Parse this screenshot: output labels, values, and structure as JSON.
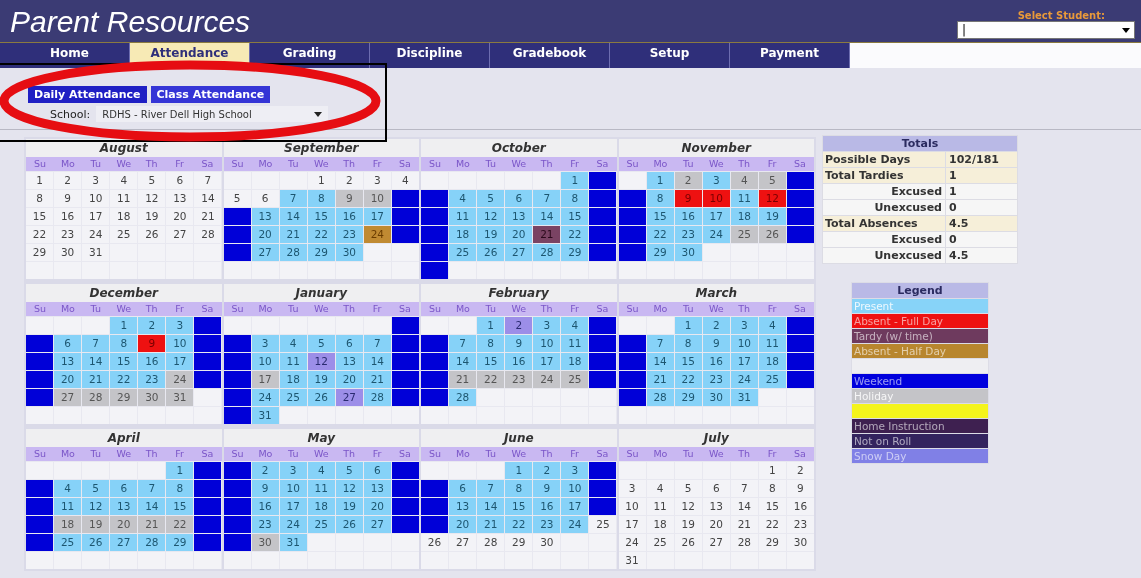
{
  "header": {
    "title": "Parent Resources",
    "student_label": "Select Student:",
    "student_value": "|"
  },
  "tabs": [
    {
      "label": "Home",
      "selected": false
    },
    {
      "label": "Attendance",
      "selected": true
    },
    {
      "label": "Grading",
      "selected": false
    },
    {
      "label": "Discipline",
      "selected": false
    },
    {
      "label": "Gradebook",
      "selected": false
    },
    {
      "label": "Setup",
      "selected": false
    },
    {
      "label": "Payment",
      "selected": false
    }
  ],
  "subtabs": [
    {
      "label": "Daily Attendance",
      "selected": true
    },
    {
      "label": "Class Attendance",
      "selected": false
    }
  ],
  "school": {
    "label": "School:",
    "value": "RDHS - River Dell High School"
  },
  "months": [
    {
      "name": "August",
      "weekdays": [
        "Su",
        "Mo",
        "Tu",
        "We",
        "Th",
        "Fr",
        "Sa"
      ],
      "weeks": [
        [
          {
            "day": "1",
            "kind": "none"
          },
          {
            "day": "2",
            "kind": "none"
          },
          {
            "day": "3",
            "kind": "none"
          },
          {
            "day": "4",
            "kind": "none"
          },
          {
            "day": "5",
            "kind": "none"
          },
          {
            "day": "6",
            "kind": "none"
          },
          {
            "day": "7",
            "kind": "none"
          }
        ],
        [
          {
            "day": "8",
            "kind": "none"
          },
          {
            "day": "9",
            "kind": "none"
          },
          {
            "day": "10",
            "kind": "none"
          },
          {
            "day": "11",
            "kind": "none"
          },
          {
            "day": "12",
            "kind": "none"
          },
          {
            "day": "13",
            "kind": "none"
          },
          {
            "day": "14",
            "kind": "none"
          }
        ],
        [
          {
            "day": "15",
            "kind": "none"
          },
          {
            "day": "16",
            "kind": "none"
          },
          {
            "day": "17",
            "kind": "none"
          },
          {
            "day": "18",
            "kind": "none"
          },
          {
            "day": "19",
            "kind": "none"
          },
          {
            "day": "20",
            "kind": "none"
          },
          {
            "day": "21",
            "kind": "none"
          }
        ],
        [
          {
            "day": "22",
            "kind": "none"
          },
          {
            "day": "23",
            "kind": "none"
          },
          {
            "day": "24",
            "kind": "none"
          },
          {
            "day": "25",
            "kind": "none"
          },
          {
            "day": "26",
            "kind": "none"
          },
          {
            "day": "27",
            "kind": "none"
          },
          {
            "day": "28",
            "kind": "none"
          }
        ],
        [
          {
            "day": "29",
            "kind": "none"
          },
          {
            "day": "30",
            "kind": "none"
          },
          {
            "day": "31",
            "kind": "none"
          }
        ]
      ]
    },
    {
      "name": "September",
      "weekdays": [
        "Su",
        "Mo",
        "Tu",
        "We",
        "Th",
        "Fr",
        "Sa"
      ],
      "weeks": [
        [
          {
            "kind": "empty"
          },
          {
            "kind": "empty"
          },
          {
            "kind": "empty"
          },
          {
            "day": "1",
            "kind": "none"
          },
          {
            "day": "2",
            "kind": "none"
          },
          {
            "day": "3",
            "kind": "none"
          },
          {
            "day": "4",
            "kind": "none"
          }
        ],
        [
          {
            "day": "5",
            "kind": "none"
          },
          {
            "day": "6",
            "kind": "none"
          },
          {
            "day": "7",
            "kind": "present"
          },
          {
            "day": "8",
            "kind": "present"
          },
          {
            "day": "9",
            "kind": "holiday"
          },
          {
            "day": "10",
            "kind": "holiday"
          },
          {
            "kind": "weekend"
          }
        ],
        [
          {
            "kind": "weekend"
          },
          {
            "day": "13",
            "kind": "present"
          },
          {
            "day": "14",
            "kind": "present"
          },
          {
            "day": "15",
            "kind": "present"
          },
          {
            "day": "16",
            "kind": "present"
          },
          {
            "day": "17",
            "kind": "present"
          },
          {
            "kind": "weekend"
          }
        ],
        [
          {
            "kind": "weekend"
          },
          {
            "day": "20",
            "kind": "present"
          },
          {
            "day": "21",
            "kind": "present"
          },
          {
            "day": "22",
            "kind": "present"
          },
          {
            "day": "23",
            "kind": "present"
          },
          {
            "day": "24",
            "kind": "half"
          },
          {
            "kind": "weekend"
          }
        ],
        [
          {
            "kind": "weekend"
          },
          {
            "day": "27",
            "kind": "present"
          },
          {
            "day": "28",
            "kind": "present"
          },
          {
            "day": "29",
            "kind": "present"
          },
          {
            "day": "30",
            "kind": "present"
          }
        ]
      ]
    },
    {
      "name": "October",
      "weekdays": [
        "Su",
        "Mo",
        "Tu",
        "We",
        "Th",
        "Fr",
        "Sa"
      ],
      "weeks": [
        [
          {
            "kind": "empty"
          },
          {
            "kind": "empty"
          },
          {
            "kind": "empty"
          },
          {
            "kind": "empty"
          },
          {
            "kind": "empty"
          },
          {
            "day": "1",
            "kind": "present"
          },
          {
            "kind": "weekend"
          }
        ],
        [
          {
            "kind": "weekend"
          },
          {
            "day": "4",
            "kind": "present"
          },
          {
            "day": "5",
            "kind": "present"
          },
          {
            "day": "6",
            "kind": "present"
          },
          {
            "day": "7",
            "kind": "present"
          },
          {
            "day": "8",
            "kind": "present"
          },
          {
            "kind": "weekend"
          }
        ],
        [
          {
            "kind": "weekend"
          },
          {
            "day": "11",
            "kind": "present"
          },
          {
            "day": "12",
            "kind": "present"
          },
          {
            "day": "13",
            "kind": "present"
          },
          {
            "day": "14",
            "kind": "present"
          },
          {
            "day": "15",
            "kind": "present"
          },
          {
            "kind": "weekend"
          }
        ],
        [
          {
            "kind": "weekend"
          },
          {
            "day": "18",
            "kind": "present"
          },
          {
            "day": "19",
            "kind": "present"
          },
          {
            "day": "20",
            "kind": "present"
          },
          {
            "day": "21",
            "kind": "tardy"
          },
          {
            "day": "22",
            "kind": "present"
          },
          {
            "kind": "weekend"
          }
        ],
        [
          {
            "kind": "weekend"
          },
          {
            "day": "25",
            "kind": "present"
          },
          {
            "day": "26",
            "kind": "present"
          },
          {
            "day": "27",
            "kind": "present"
          },
          {
            "day": "28",
            "kind": "present"
          },
          {
            "day": "29",
            "kind": "present"
          },
          {
            "kind": "weekend"
          }
        ],
        [
          {
            "kind": "weekend"
          }
        ]
      ]
    },
    {
      "name": "November",
      "weekdays": [
        "Su",
        "Mo",
        "Tu",
        "We",
        "Th",
        "Fr",
        "Sa"
      ],
      "weeks": [
        [
          {
            "kind": "empty"
          },
          {
            "day": "1",
            "kind": "present"
          },
          {
            "day": "2",
            "kind": "holiday"
          },
          {
            "day": "3",
            "kind": "present"
          },
          {
            "day": "4",
            "kind": "holiday"
          },
          {
            "day": "5",
            "kind": "holiday"
          },
          {
            "kind": "weekend"
          }
        ],
        [
          {
            "kind": "weekend"
          },
          {
            "day": "8",
            "kind": "present"
          },
          {
            "day": "9",
            "kind": "absent"
          },
          {
            "day": "10",
            "kind": "absent"
          },
          {
            "day": "11",
            "kind": "present"
          },
          {
            "day": "12",
            "kind": "absent"
          },
          {
            "kind": "weekend"
          }
        ],
        [
          {
            "kind": "weekend"
          },
          {
            "day": "15",
            "kind": "present"
          },
          {
            "day": "16",
            "kind": "present"
          },
          {
            "day": "17",
            "kind": "present"
          },
          {
            "day": "18",
            "kind": "present"
          },
          {
            "day": "19",
            "kind": "present"
          },
          {
            "kind": "weekend"
          }
        ],
        [
          {
            "kind": "weekend"
          },
          {
            "day": "22",
            "kind": "present"
          },
          {
            "day": "23",
            "kind": "present"
          },
          {
            "day": "24",
            "kind": "present"
          },
          {
            "day": "25",
            "kind": "holiday"
          },
          {
            "day": "26",
            "kind": "holiday"
          },
          {
            "kind": "weekend"
          }
        ],
        [
          {
            "kind": "weekend"
          },
          {
            "day": "29",
            "kind": "present"
          },
          {
            "day": "30",
            "kind": "present"
          }
        ]
      ]
    },
    {
      "name": "December",
      "weekdays": [
        "Su",
        "Mo",
        "Tu",
        "We",
        "Th",
        "Fr",
        "Sa"
      ],
      "weeks": [
        [
          {
            "kind": "empty"
          },
          {
            "kind": "empty"
          },
          {
            "kind": "empty"
          },
          {
            "day": "1",
            "kind": "present"
          },
          {
            "day": "2",
            "kind": "present"
          },
          {
            "day": "3",
            "kind": "present"
          },
          {
            "kind": "weekend"
          }
        ],
        [
          {
            "kind": "weekend"
          },
          {
            "day": "6",
            "kind": "present"
          },
          {
            "day": "7",
            "kind": "present"
          },
          {
            "day": "8",
            "kind": "present"
          },
          {
            "day": "9",
            "kind": "absent"
          },
          {
            "day": "10",
            "kind": "present"
          },
          {
            "kind": "weekend"
          }
        ],
        [
          {
            "kind": "weekend"
          },
          {
            "day": "13",
            "kind": "present"
          },
          {
            "day": "14",
            "kind": "present"
          },
          {
            "day": "15",
            "kind": "present"
          },
          {
            "day": "16",
            "kind": "present"
          },
          {
            "day": "17",
            "kind": "present"
          },
          {
            "kind": "weekend"
          }
        ],
        [
          {
            "kind": "weekend"
          },
          {
            "day": "20",
            "kind": "present"
          },
          {
            "day": "21",
            "kind": "present"
          },
          {
            "day": "22",
            "kind": "present"
          },
          {
            "day": "23",
            "kind": "present"
          },
          {
            "day": "24",
            "kind": "holiday"
          },
          {
            "kind": "weekend"
          }
        ],
        [
          {
            "kind": "weekend"
          },
          {
            "day": "27",
            "kind": "holiday"
          },
          {
            "day": "28",
            "kind": "holiday"
          },
          {
            "day": "29",
            "kind": "holiday"
          },
          {
            "day": "30",
            "kind": "holiday"
          },
          {
            "day": "31",
            "kind": "holiday"
          }
        ]
      ]
    },
    {
      "name": "January",
      "weekdays": [
        "Su",
        "Mo",
        "Tu",
        "We",
        "Th",
        "Fr",
        "Sa"
      ],
      "weeks": [
        [
          {
            "kind": "empty"
          },
          {
            "kind": "empty"
          },
          {
            "kind": "empty"
          },
          {
            "kind": "empty"
          },
          {
            "kind": "empty"
          },
          {
            "kind": "empty"
          },
          {
            "kind": "weekend"
          }
        ],
        [
          {
            "kind": "weekend"
          },
          {
            "day": "3",
            "kind": "present"
          },
          {
            "day": "4",
            "kind": "present"
          },
          {
            "day": "5",
            "kind": "present"
          },
          {
            "day": "6",
            "kind": "present"
          },
          {
            "day": "7",
            "kind": "present"
          },
          {
            "kind": "weekend"
          }
        ],
        [
          {
            "kind": "weekend"
          },
          {
            "day": "10",
            "kind": "present"
          },
          {
            "day": "11",
            "kind": "present"
          },
          {
            "day": "12",
            "kind": "snow"
          },
          {
            "day": "13",
            "kind": "present"
          },
          {
            "day": "14",
            "kind": "present"
          },
          {
            "kind": "weekend"
          }
        ],
        [
          {
            "kind": "weekend"
          },
          {
            "day": "17",
            "kind": "holiday"
          },
          {
            "day": "18",
            "kind": "present"
          },
          {
            "day": "19",
            "kind": "present"
          },
          {
            "day": "20",
            "kind": "present"
          },
          {
            "day": "21",
            "kind": "present"
          },
          {
            "kind": "weekend"
          }
        ],
        [
          {
            "kind": "weekend"
          },
          {
            "day": "24",
            "kind": "present"
          },
          {
            "day": "25",
            "kind": "present"
          },
          {
            "day": "26",
            "kind": "present"
          },
          {
            "day": "27",
            "kind": "snow"
          },
          {
            "day": "28",
            "kind": "present"
          },
          {
            "kind": "weekend"
          }
        ],
        [
          {
            "kind": "weekend"
          },
          {
            "day": "31",
            "kind": "present"
          }
        ]
      ]
    },
    {
      "name": "February",
      "weekdays": [
        "Su",
        "Mo",
        "Tu",
        "We",
        "Th",
        "Fr",
        "Sa"
      ],
      "weeks": [
        [
          {
            "kind": "empty"
          },
          {
            "kind": "empty"
          },
          {
            "day": "1",
            "kind": "present"
          },
          {
            "day": "2",
            "kind": "snow"
          },
          {
            "day": "3",
            "kind": "present"
          },
          {
            "day": "4",
            "kind": "present"
          },
          {
            "kind": "weekend"
          }
        ],
        [
          {
            "kind": "weekend"
          },
          {
            "day": "7",
            "kind": "present"
          },
          {
            "day": "8",
            "kind": "present"
          },
          {
            "day": "9",
            "kind": "present"
          },
          {
            "day": "10",
            "kind": "present"
          },
          {
            "day": "11",
            "kind": "present"
          },
          {
            "kind": "weekend"
          }
        ],
        [
          {
            "kind": "weekend"
          },
          {
            "day": "14",
            "kind": "present"
          },
          {
            "day": "15",
            "kind": "present"
          },
          {
            "day": "16",
            "kind": "present"
          },
          {
            "day": "17",
            "kind": "present"
          },
          {
            "day": "18",
            "kind": "present"
          },
          {
            "kind": "weekend"
          }
        ],
        [
          {
            "kind": "weekend"
          },
          {
            "day": "21",
            "kind": "holiday"
          },
          {
            "day": "22",
            "kind": "holiday"
          },
          {
            "day": "23",
            "kind": "holiday"
          },
          {
            "day": "24",
            "kind": "holiday"
          },
          {
            "day": "25",
            "kind": "holiday"
          },
          {
            "kind": "weekend"
          }
        ],
        [
          {
            "kind": "weekend"
          },
          {
            "day": "28",
            "kind": "present"
          }
        ]
      ]
    },
    {
      "name": "March",
      "weekdays": [
        "Su",
        "Mo",
        "Tu",
        "We",
        "Th",
        "Fr",
        "Sa"
      ],
      "weeks": [
        [
          {
            "kind": "empty"
          },
          {
            "kind": "empty"
          },
          {
            "day": "1",
            "kind": "present"
          },
          {
            "day": "2",
            "kind": "present"
          },
          {
            "day": "3",
            "kind": "present"
          },
          {
            "day": "4",
            "kind": "present"
          },
          {
            "kind": "weekend"
          }
        ],
        [
          {
            "kind": "weekend"
          },
          {
            "day": "7",
            "kind": "present"
          },
          {
            "day": "8",
            "kind": "present"
          },
          {
            "day": "9",
            "kind": "present"
          },
          {
            "day": "10",
            "kind": "present"
          },
          {
            "day": "11",
            "kind": "present"
          },
          {
            "kind": "weekend"
          }
        ],
        [
          {
            "kind": "weekend"
          },
          {
            "day": "14",
            "kind": "present"
          },
          {
            "day": "15",
            "kind": "present"
          },
          {
            "day": "16",
            "kind": "present"
          },
          {
            "day": "17",
            "kind": "present"
          },
          {
            "day": "18",
            "kind": "present"
          },
          {
            "kind": "weekend"
          }
        ],
        [
          {
            "kind": "weekend"
          },
          {
            "day": "21",
            "kind": "present"
          },
          {
            "day": "22",
            "kind": "present"
          },
          {
            "day": "23",
            "kind": "present"
          },
          {
            "day": "24",
            "kind": "present"
          },
          {
            "day": "25",
            "kind": "present"
          },
          {
            "kind": "weekend"
          }
        ],
        [
          {
            "kind": "weekend"
          },
          {
            "day": "28",
            "kind": "present"
          },
          {
            "day": "29",
            "kind": "present"
          },
          {
            "day": "30",
            "kind": "present"
          },
          {
            "day": "31",
            "kind": "present"
          }
        ]
      ]
    },
    {
      "name": "April",
      "weekdays": [
        "Su",
        "Mo",
        "Tu",
        "We",
        "Th",
        "Fr",
        "Sa"
      ],
      "weeks": [
        [
          {
            "kind": "empty"
          },
          {
            "kind": "empty"
          },
          {
            "kind": "empty"
          },
          {
            "kind": "empty"
          },
          {
            "kind": "empty"
          },
          {
            "day": "1",
            "kind": "present"
          },
          {
            "kind": "weekend"
          }
        ],
        [
          {
            "kind": "weekend"
          },
          {
            "day": "4",
            "kind": "present"
          },
          {
            "day": "5",
            "kind": "present"
          },
          {
            "day": "6",
            "kind": "present"
          },
          {
            "day": "7",
            "kind": "present"
          },
          {
            "day": "8",
            "kind": "present"
          },
          {
            "kind": "weekend"
          }
        ],
        [
          {
            "kind": "weekend"
          },
          {
            "day": "11",
            "kind": "present"
          },
          {
            "day": "12",
            "kind": "present"
          },
          {
            "day": "13",
            "kind": "present"
          },
          {
            "day": "14",
            "kind": "present"
          },
          {
            "day": "15",
            "kind": "present"
          },
          {
            "kind": "weekend"
          }
        ],
        [
          {
            "kind": "weekend"
          },
          {
            "day": "18",
            "kind": "holiday"
          },
          {
            "day": "19",
            "kind": "holiday"
          },
          {
            "day": "20",
            "kind": "holiday"
          },
          {
            "day": "21",
            "kind": "holiday"
          },
          {
            "day": "22",
            "kind": "holiday"
          },
          {
            "kind": "weekend"
          }
        ],
        [
          {
            "kind": "weekend"
          },
          {
            "day": "25",
            "kind": "present"
          },
          {
            "day": "26",
            "kind": "present"
          },
          {
            "day": "27",
            "kind": "present"
          },
          {
            "day": "28",
            "kind": "present"
          },
          {
            "day": "29",
            "kind": "present"
          },
          {
            "kind": "weekend"
          }
        ]
      ]
    },
    {
      "name": "May",
      "weekdays": [
        "Su",
        "Mo",
        "Tu",
        "We",
        "Th",
        "Fr",
        "Sa"
      ],
      "weeks": [
        [
          {
            "kind": "weekend"
          },
          {
            "day": "2",
            "kind": "present"
          },
          {
            "day": "3",
            "kind": "present"
          },
          {
            "day": "4",
            "kind": "present"
          },
          {
            "day": "5",
            "kind": "present"
          },
          {
            "day": "6",
            "kind": "present"
          },
          {
            "kind": "weekend"
          }
        ],
        [
          {
            "kind": "weekend"
          },
          {
            "day": "9",
            "kind": "present"
          },
          {
            "day": "10",
            "kind": "present"
          },
          {
            "day": "11",
            "kind": "present"
          },
          {
            "day": "12",
            "kind": "present"
          },
          {
            "day": "13",
            "kind": "present"
          },
          {
            "kind": "weekend"
          }
        ],
        [
          {
            "kind": "weekend"
          },
          {
            "day": "16",
            "kind": "present"
          },
          {
            "day": "17",
            "kind": "present"
          },
          {
            "day": "18",
            "kind": "present"
          },
          {
            "day": "19",
            "kind": "present"
          },
          {
            "day": "20",
            "kind": "present"
          },
          {
            "kind": "weekend"
          }
        ],
        [
          {
            "kind": "weekend"
          },
          {
            "day": "23",
            "kind": "present"
          },
          {
            "day": "24",
            "kind": "present"
          },
          {
            "day": "25",
            "kind": "present"
          },
          {
            "day": "26",
            "kind": "present"
          },
          {
            "day": "27",
            "kind": "present"
          },
          {
            "kind": "weekend"
          }
        ],
        [
          {
            "kind": "weekend"
          },
          {
            "day": "30",
            "kind": "holiday"
          },
          {
            "day": "31",
            "kind": "present"
          }
        ]
      ]
    },
    {
      "name": "June",
      "weekdays": [
        "Su",
        "Mo",
        "Tu",
        "We",
        "Th",
        "Fr",
        "Sa"
      ],
      "weeks": [
        [
          {
            "kind": "empty"
          },
          {
            "kind": "empty"
          },
          {
            "kind": "empty"
          },
          {
            "day": "1",
            "kind": "present"
          },
          {
            "day": "2",
            "kind": "present"
          },
          {
            "day": "3",
            "kind": "present"
          },
          {
            "kind": "weekend"
          }
        ],
        [
          {
            "kind": "weekend"
          },
          {
            "day": "6",
            "kind": "present"
          },
          {
            "day": "7",
            "kind": "present"
          },
          {
            "day": "8",
            "kind": "present"
          },
          {
            "day": "9",
            "kind": "present"
          },
          {
            "day": "10",
            "kind": "present"
          },
          {
            "kind": "weekend"
          }
        ],
        [
          {
            "kind": "weekend"
          },
          {
            "day": "13",
            "kind": "present"
          },
          {
            "day": "14",
            "kind": "present"
          },
          {
            "day": "15",
            "kind": "present"
          },
          {
            "day": "16",
            "kind": "present"
          },
          {
            "day": "17",
            "kind": "present"
          },
          {
            "kind": "weekend"
          }
        ],
        [
          {
            "kind": "weekend"
          },
          {
            "day": "20",
            "kind": "present"
          },
          {
            "day": "21",
            "kind": "present"
          },
          {
            "day": "22",
            "kind": "present"
          },
          {
            "day": "23",
            "kind": "present"
          },
          {
            "day": "24",
            "kind": "present"
          },
          {
            "day": "25",
            "kind": "none"
          }
        ],
        [
          {
            "day": "26",
            "kind": "none"
          },
          {
            "day": "27",
            "kind": "none"
          },
          {
            "day": "28",
            "kind": "none"
          },
          {
            "day": "29",
            "kind": "none"
          },
          {
            "day": "30",
            "kind": "none"
          }
        ]
      ]
    },
    {
      "name": "July",
      "weekdays": [
        "Su",
        "Mo",
        "Tu",
        "We",
        "Th",
        "Fr",
        "Sa"
      ],
      "weeks": [
        [
          {
            "kind": "empty"
          },
          {
            "kind": "empty"
          },
          {
            "kind": "empty"
          },
          {
            "kind": "empty"
          },
          {
            "kind": "empty"
          },
          {
            "day": "1",
            "kind": "none"
          },
          {
            "day": "2",
            "kind": "none"
          }
        ],
        [
          {
            "day": "3",
            "kind": "none"
          },
          {
            "day": "4",
            "kind": "none"
          },
          {
            "day": "5",
            "kind": "none"
          },
          {
            "day": "6",
            "kind": "none"
          },
          {
            "day": "7",
            "kind": "none"
          },
          {
            "day": "8",
            "kind": "none"
          },
          {
            "day": "9",
            "kind": "none"
          }
        ],
        [
          {
            "day": "10",
            "kind": "none"
          },
          {
            "day": "11",
            "kind": "none"
          },
          {
            "day": "12",
            "kind": "none"
          },
          {
            "day": "13",
            "kind": "none"
          },
          {
            "day": "14",
            "kind": "none"
          },
          {
            "day": "15",
            "kind": "none"
          },
          {
            "day": "16",
            "kind": "none"
          }
        ],
        [
          {
            "day": "17",
            "kind": "none"
          },
          {
            "day": "18",
            "kind": "none"
          },
          {
            "day": "19",
            "kind": "none"
          },
          {
            "day": "20",
            "kind": "none"
          },
          {
            "day": "21",
            "kind": "none"
          },
          {
            "day": "22",
            "kind": "none"
          },
          {
            "day": "23",
            "kind": "none"
          }
        ],
        [
          {
            "day": "24",
            "kind": "none"
          },
          {
            "day": "25",
            "kind": "none"
          },
          {
            "day": "26",
            "kind": "none"
          },
          {
            "day": "27",
            "kind": "none"
          },
          {
            "day": "28",
            "kind": "none"
          },
          {
            "day": "29",
            "kind": "none"
          },
          {
            "day": "30",
            "kind": "none"
          }
        ],
        [
          {
            "day": "31",
            "kind": "none"
          }
        ]
      ]
    }
  ],
  "totals": {
    "title": "Totals",
    "rows": [
      {
        "label": "Possible Days",
        "value": "102/181",
        "kind": "total"
      },
      {
        "label": "Total Tardies",
        "value": "1",
        "kind": "total"
      },
      {
        "label": "Excused",
        "value": "1",
        "kind": "sub"
      },
      {
        "label": "Unexcused",
        "value": "0",
        "kind": "sub"
      },
      {
        "label": "Total Absences",
        "value": "4.5",
        "kind": "total"
      },
      {
        "label": "Excused",
        "value": "0",
        "kind": "sub"
      },
      {
        "label": "Unexcused",
        "value": "4.5",
        "kind": "sub"
      }
    ]
  },
  "legend": {
    "title": "Legend",
    "items": [
      {
        "label": "Present",
        "color": "#87d3f8"
      },
      {
        "label": "Absent - Full Day",
        "color": "#ee1111"
      },
      {
        "label": "Tardy (w/ time)",
        "color": "#6e3a5e"
      },
      {
        "label": "Absent - Half Day",
        "color": "#b8862e"
      },
      {
        "color": "#eeeef2"
      },
      {
        "label": "Weekend",
        "color": "#0000dd"
      },
      {
        "label": "Holiday",
        "color": "#c4c4c8"
      },
      {
        "color": "#f4f41c"
      },
      {
        "label": "Home Instruction",
        "color": "#3e2050"
      },
      {
        "label": "Not on Roll",
        "color": "#33235e"
      },
      {
        "label": "Snow Day",
        "color": "#8080e6"
      }
    ]
  }
}
